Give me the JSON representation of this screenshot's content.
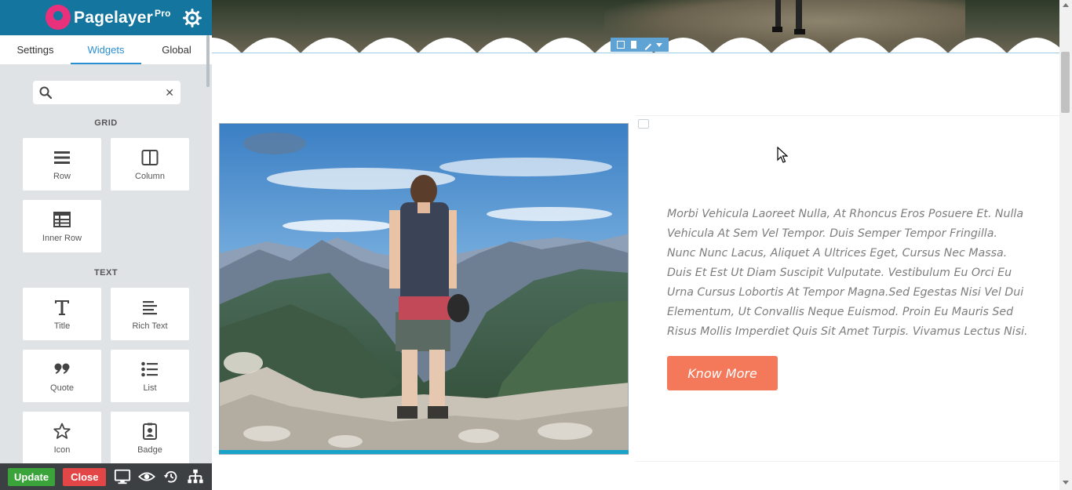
{
  "sidebar": {
    "brand": "Pagelayer",
    "brand_badge": "Pro",
    "tabs": [
      {
        "label": "Settings"
      },
      {
        "label": "Widgets"
      },
      {
        "label": "Global"
      }
    ],
    "search": {
      "value": "",
      "clear_icon": "close-icon",
      "icon": "search-icon"
    },
    "sections": [
      {
        "label": "GRID",
        "widgets": [
          {
            "label": "Row",
            "icon": "row-icon"
          },
          {
            "label": "Column",
            "icon": "column-icon"
          },
          {
            "label": "Inner Row",
            "icon": "inner-row-icon"
          }
        ]
      },
      {
        "label": "TEXT",
        "widgets": [
          {
            "label": "Title",
            "icon": "title-icon"
          },
          {
            "label": "Rich Text",
            "icon": "rich-text-icon"
          },
          {
            "label": "Quote",
            "icon": "quote-icon"
          },
          {
            "label": "List",
            "icon": "list-icon"
          },
          {
            "label": "Icon",
            "icon": "star-icon"
          },
          {
            "label": "Badge",
            "icon": "badge-icon"
          }
        ]
      }
    ],
    "bottom": {
      "update_label": "Update",
      "close_label": "Close",
      "icons": [
        "desktop-icon",
        "eye-icon",
        "history-icon",
        "navigator-icon"
      ]
    }
  },
  "canvas": {
    "paragraph": "Morbi Vehicula Laoreet Nulla, At Rhoncus Eros Posuere Et. Nulla Vehicula At Sem Vel Tempor. Duis Semper Tempor Fringilla. Nunc Nunc Lacus, Aliquet A Ultrices Eget, Cursus Nec Massa. Duis Et Est Ut Diam Suscipit Vulputate. Vestibulum Eu Orci Eu Urna Cursus Lobortis At Tempor Magna.Sed Egestas Nisi Vel Dui Elementum, Ut Convallis Neque Euismod. Proin Eu Mauris Sed Risus Mollis Imperdiet Quis Sit Amet Turpis. Vivamus Lectus Nisi.",
    "button_label": "Know More",
    "colors": {
      "header": "#14769f",
      "accent": "#2a8fd0",
      "button": "#f4785a",
      "update": "#3aa33a",
      "close": "#e24646"
    }
  }
}
